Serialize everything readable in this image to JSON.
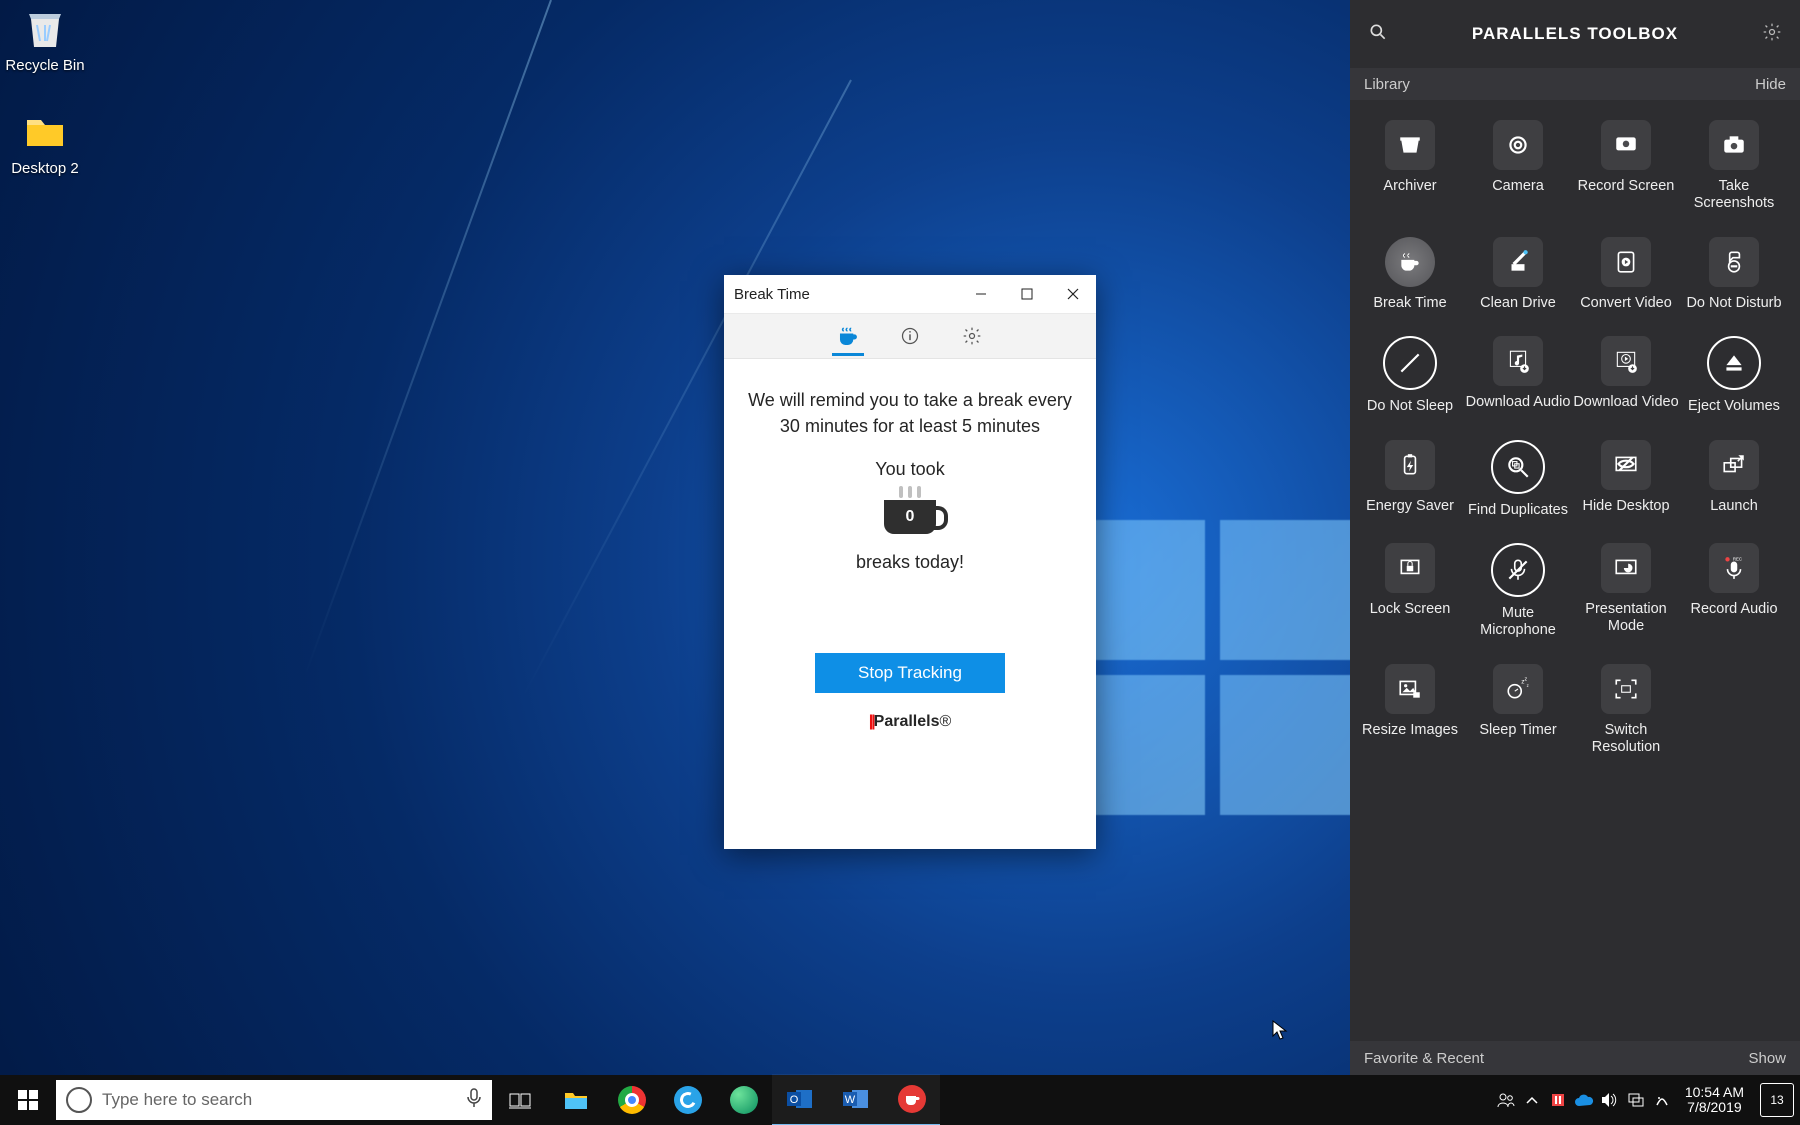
{
  "desktop": {
    "icons": [
      {
        "label": "Recycle Bin"
      },
      {
        "label": "Desktop 2"
      }
    ]
  },
  "break_window": {
    "title": "Break Time",
    "message": "We will remind you to take a break every 30 minutes for at least 5 minutes",
    "you_took": "You took",
    "count": "0",
    "breaks_today": "breaks today!",
    "button": "Stop Tracking",
    "brand": "Parallels"
  },
  "panel": {
    "title": "PARALLELS TOOLBOX",
    "library": "Library",
    "hide": "Hide",
    "favorite": "Favorite & Recent",
    "show": "Show",
    "tools": [
      {
        "label": "Archiver"
      },
      {
        "label": "Camera"
      },
      {
        "label": "Record Screen"
      },
      {
        "label": "Take Screenshots"
      },
      {
        "label": "Break Time"
      },
      {
        "label": "Clean Drive"
      },
      {
        "label": "Convert Video"
      },
      {
        "label": "Do Not Disturb"
      },
      {
        "label": "Do Not Sleep"
      },
      {
        "label": "Download Audio"
      },
      {
        "label": "Download Video"
      },
      {
        "label": "Eject Volumes"
      },
      {
        "label": "Energy Saver"
      },
      {
        "label": "Find Duplicates"
      },
      {
        "label": "Hide Desktop"
      },
      {
        "label": "Launch"
      },
      {
        "label": "Lock Screen"
      },
      {
        "label": "Mute Microphone"
      },
      {
        "label": "Presentation Mode"
      },
      {
        "label": "Record Audio"
      },
      {
        "label": "Resize Images"
      },
      {
        "label": "Sleep Timer"
      },
      {
        "label": "Switch Resolution"
      }
    ]
  },
  "taskbar": {
    "search_placeholder": "Type here to search",
    "time": "10:54 AM",
    "date": "7/8/2019",
    "notif_count": "13"
  }
}
